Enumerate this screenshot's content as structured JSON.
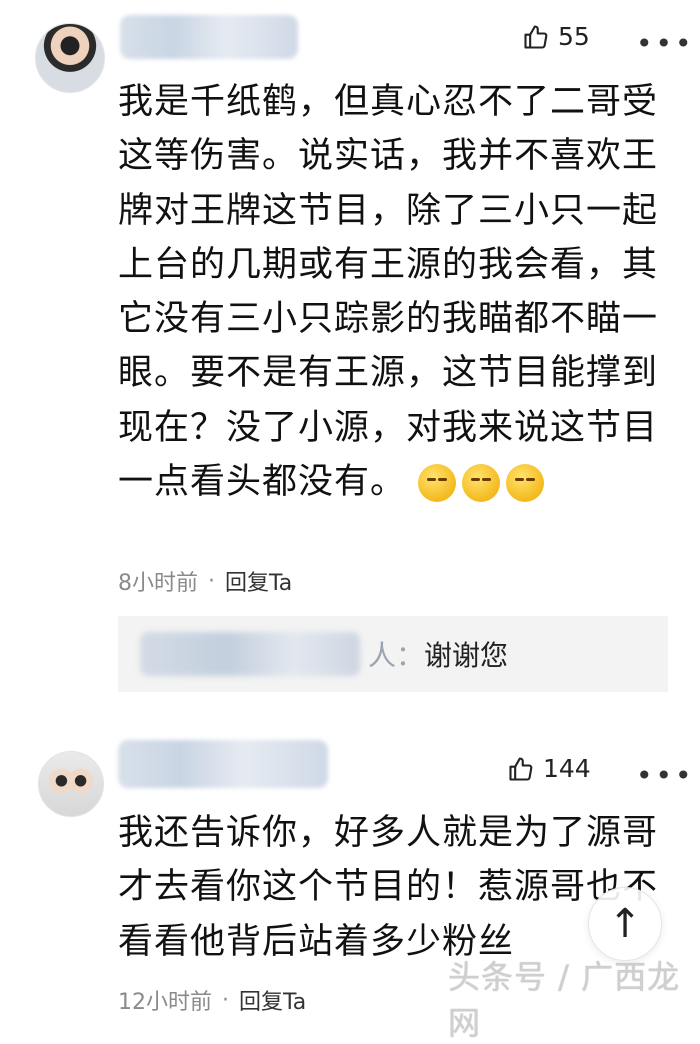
{
  "comments": [
    {
      "likes": "55",
      "text": "我是千纸鹤，但真心忍不了二哥受这等伤害。说实话，我并不喜欢王牌对王牌这节目，除了三小只一起上台的几期或有王源的我会看，其它没有三小只踪影的我瞄都不瞄一眼。要不是有王源，这节目能撑到现在？没了小源，对我来说这节目一点看头都没有。",
      "emoji_count": 3,
      "time": "8小时前",
      "separator": "·",
      "reply_label": "回复Ta",
      "reply": {
        "lead": "人：",
        "text": "谢谢您"
      }
    },
    {
      "likes": "144",
      "text": "我还告诉你，好多人就是为了源哥才去看你这个节目的！惹源哥也不看看他背后站着多少粉丝",
      "time": "12小时前",
      "separator": "·",
      "reply_label": "回复Ta"
    }
  ],
  "more_glyph": "•••",
  "scroll_top_glyph": "↑",
  "watermark": "头条号 / 广西龙网"
}
